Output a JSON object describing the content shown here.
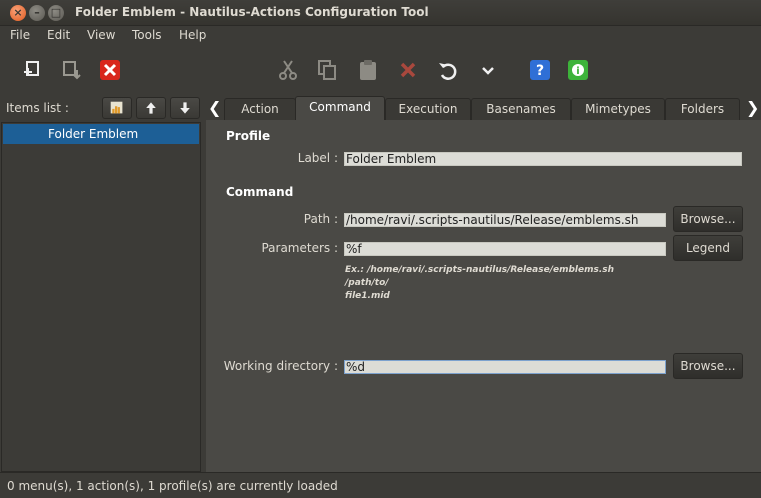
{
  "window": {
    "title": "Folder Emblem - Nautilus-Actions Configuration Tool"
  },
  "menubar": [
    "File",
    "Edit",
    "View",
    "Tools",
    "Help"
  ],
  "toolbar": {
    "icons": [
      "new-item-icon",
      "import-icon",
      "delete-icon",
      "cut-icon",
      "copy-icon",
      "paste-icon",
      "remove-icon",
      "undo-icon",
      "chevron-down-icon",
      "help-icon",
      "about-icon"
    ],
    "accent_red": "#d9261c",
    "accent_blue": "#2f6fd6",
    "accent_green": "#3db33a"
  },
  "left": {
    "items_label": "Items list :",
    "tree": [
      {
        "label": "Folder Emblem",
        "selected": true
      }
    ],
    "selection_color": "#1d5f96"
  },
  "tabs": [
    "Action",
    "Command",
    "Execution",
    "Basenames",
    "Mimetypes",
    "Folders"
  ],
  "active_tab": "Command",
  "profile": {
    "section": "Profile",
    "label_caption": "Label :",
    "label_value": "Folder Emblem"
  },
  "command": {
    "section": "Command",
    "path_caption": "Path :",
    "path_value": "/home/ravi/.scripts-nautilus/Release/emblems.sh",
    "path_browse": "Browse...",
    "params_caption": "Parameters :",
    "params_value": "%f",
    "legend_button": "Legend",
    "example_line1": "Ex.: /home/ravi/.scripts-nautilus/Release/emblems.sh /path/to/",
    "example_line2": "file1.mid",
    "workdir_caption": "Working directory :",
    "workdir_value": "%d",
    "workdir_browse": "Browse..."
  },
  "status": "0 menu(s), 1 action(s), 1 profile(s) are currently loaded"
}
